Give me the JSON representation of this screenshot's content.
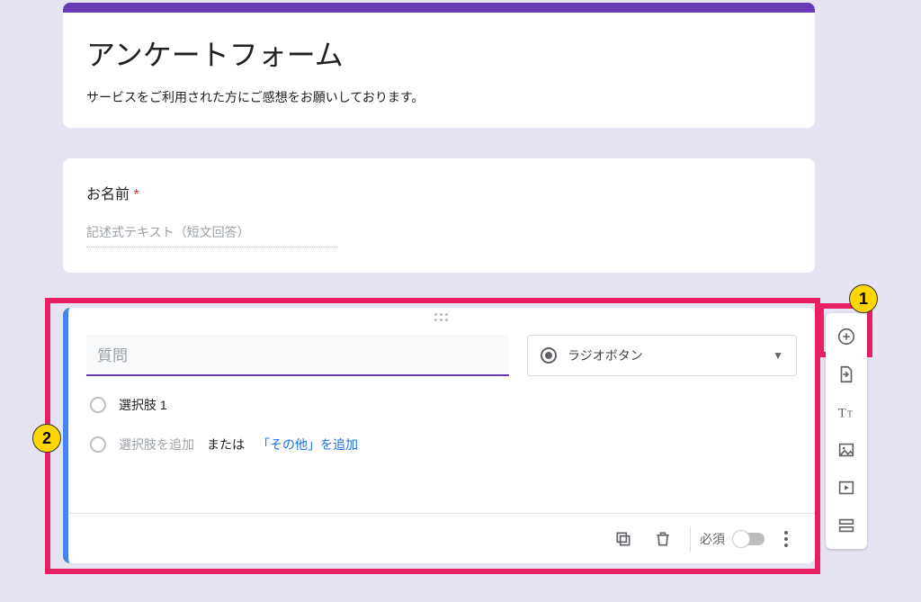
{
  "form": {
    "title": "アンケートフォーム",
    "description": "サービスをご利用された方にご感想をお願いしております。"
  },
  "nameQuestion": {
    "title": "お名前",
    "requiredMark": "*",
    "answerPlaceholder": "記述式テキスト（短文回答）"
  },
  "questionCard": {
    "questionPlaceholder": "質問",
    "typeSelected": "ラジオボタン",
    "option1": "選択肢 1",
    "addOptionText": "選択肢を追加",
    "orText": " または ",
    "addOtherText": "「その他」を追加",
    "requiredLabel": "必須"
  },
  "callouts": {
    "badge1": "1",
    "badge2": "2"
  },
  "toolbar": {
    "addQuestion": "add-question",
    "importQuestions": "import-questions",
    "addTitle": "add-title",
    "addImage": "add-image",
    "addVideo": "add-video",
    "addSection": "add-section"
  }
}
